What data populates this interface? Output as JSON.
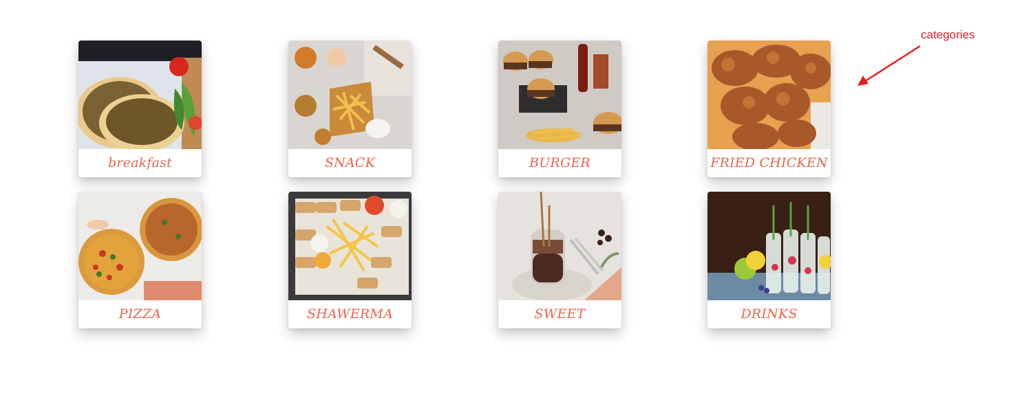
{
  "annotation": {
    "text": "categories",
    "color": "#e21f1f"
  },
  "accent_color": "#e8644a",
  "categories": [
    {
      "label": "breakfast",
      "image": "manakish-zaatar-photo"
    },
    {
      "label": "SNACK",
      "image": "snack-platter-photo"
    },
    {
      "label": "BURGER",
      "image": "burgers-and-cola-photo"
    },
    {
      "label": "FRIED CHICKEN",
      "image": "fried-chicken-photo"
    },
    {
      "label": "PIZZA",
      "image": "pizza-photo"
    },
    {
      "label": "SHAWERMA",
      "image": "shawarma-wraps-photo"
    },
    {
      "label": "SWEET",
      "image": "chocolate-dessert-jar-photo"
    },
    {
      "label": "DRINKS",
      "image": "lemonade-bottles-photo"
    }
  ]
}
